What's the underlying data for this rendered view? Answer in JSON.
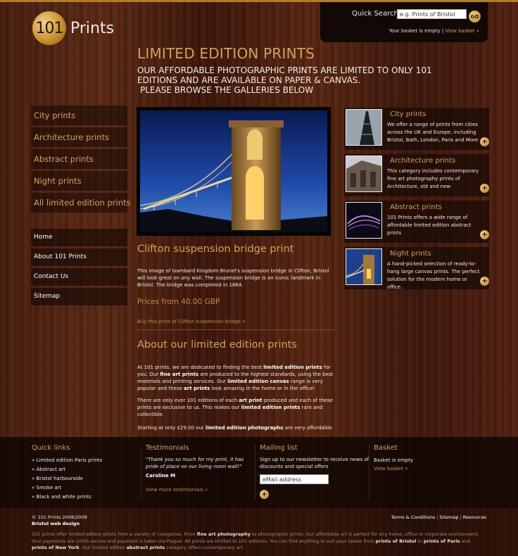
{
  "header": {
    "logo_number": "101",
    "logo_word": "Prints",
    "search_label": "Quick Search",
    "search_value": "e.g. Prints of Bristol",
    "search_go": "GO",
    "basket_status": "Your basket is empty",
    "basket_sep": " | ",
    "basket_link": "View basket »"
  },
  "intro": {
    "title": "LIMITED EDITION PRINTS",
    "text_1": "OUR AFFORDABLE PHOTOGRAPHIC PRINTS ARE LIMITED TO ONLY 101 EDITIONS AND ARE AVAILABLE ON PAPER & CANVAS.",
    "text_2": "PLEASE BROWSE THE GALLERIES BELOW"
  },
  "category_nav": [
    {
      "label": "City prints"
    },
    {
      "label": "Architecture prints"
    },
    {
      "label": "Abstract prints"
    },
    {
      "label": "Night prints"
    },
    {
      "label": "All limited edition prints"
    }
  ],
  "main_nav": [
    {
      "label": "Home"
    },
    {
      "label": "About 101 Prints"
    },
    {
      "label": "Contact Us"
    },
    {
      "label": "Sitemap"
    }
  ],
  "feature": {
    "title": "Clifton suspension bridge print",
    "description": "This image of Isambard Kingdom Brunel's suspension bridge in Clifton, Bristol will look great on any wall. The suspension bridge is an iconic landmark in Bristol. The bridge was completed in 1864.",
    "price": "Prices from 40.00 GBP",
    "buy_link": "Buy this print of Clifton suspension bridge »"
  },
  "about": {
    "title": "About our limited edition prints",
    "p1": [
      {
        "t": "At 101 prints, we are dedicated to finding the best "
      },
      {
        "t": "limited edition prints",
        "b": true
      },
      {
        "t": " for you. Our "
      },
      {
        "t": "fine art prints",
        "b": true
      },
      {
        "t": " are produced to the highest standards, using the best materials and printing services. Our "
      },
      {
        "t": "limited edition canvas",
        "b": true
      },
      {
        "t": " range is very popular and these "
      },
      {
        "t": "art prints",
        "b": true
      },
      {
        "t": " look amazing in the home or in the office!"
      }
    ],
    "p2": [
      {
        "t": "There are only ever 101 editions of each "
      },
      {
        "t": "art print",
        "b": true
      },
      {
        "t": " produced and each of these prints are exclusive to us. This makes our "
      },
      {
        "t": "limited edition prints",
        "b": true
      },
      {
        "t": " rare and collectible."
      }
    ],
    "p3": [
      {
        "t": "Starting at only £29.00 our "
      },
      {
        "t": "limited edition photographs",
        "b": true
      },
      {
        "t": " are very affordable."
      }
    ]
  },
  "right_categories": [
    {
      "title": "City prints",
      "desc": "We offer a range of prints from cities across the UK and Europe, including Bristol, Bath, London, Paris and More",
      "more": "+"
    },
    {
      "title": "Architecture prints",
      "desc": "This category includes contemporary fine art photography prints of Architecture, old and new",
      "more": "+"
    },
    {
      "title": "Abstract prints",
      "desc": "101 Prints offers a wide range of affordable limited edition abstract prints",
      "more": "+"
    },
    {
      "title": "Night prints",
      "desc": "A hand-picked selection of ready-to-hang large canvas prints. The perfect solution for the modern home or office.",
      "more": "+"
    }
  ],
  "footer": {
    "quick_links": {
      "heading": "Quick links",
      "items": [
        "» Limited edition Paris prints",
        "» Abstract art",
        "» Bristol harbourside",
        "» Smoke art",
        "» Black and white prints"
      ]
    },
    "testimonials": {
      "heading": "Testimonials",
      "quote": "\"Thank you so much for my print, it has pride of place on our living room wall!\"",
      "author": "Caroline M",
      "link": "View more testimonials »"
    },
    "mailing": {
      "heading": "Mailing list",
      "text": "Sign up to our newsletter to receive news of discounts and special offers",
      "input_value": "eMail address",
      "go": "+"
    },
    "basket": {
      "heading": "Basket",
      "status": "Basket is empty",
      "link": "View basket »"
    }
  },
  "bottom": {
    "copyright": "© 101 Prints 2008/2009",
    "web_design": "Bristol web design",
    "legal": [
      "Terms & Conditions",
      "Sitemap",
      "Resources"
    ],
    "legal_sep": " | ",
    "seo": [
      {
        "t": "101 prints offer limited edition prints from a variety of categories. From "
      },
      {
        "t": "fine art photography",
        "b": true
      },
      {
        "t": " to photographic prints. Our affordable art is perfect for any home, office or corporate environment. Your payments are 100% secure and payment is taken via Paypal. All prints are limited to 101 editions. You can find anything to suit your tastes from "
      },
      {
        "t": "prints of Bristol",
        "b": true
      },
      {
        "t": " to "
      },
      {
        "t": "prints of Paris",
        "b": true
      },
      {
        "t": " and "
      },
      {
        "t": "prints of New York",
        "b": true
      },
      {
        "t": ". Our limited edition "
      },
      {
        "t": "abstract prints",
        "b": true
      },
      {
        "t": " category offers contemporary art."
      }
    ]
  },
  "icons": {
    "go": "go-circle-icon",
    "plus": "plus-circle-icon",
    "bullet": "chevron-bullet"
  },
  "colors": {
    "accent_gold": "#d4a060",
    "link_gold": "#c48a4c",
    "wood_dark": "#4a1f10",
    "panel_dark": "#120806"
  }
}
